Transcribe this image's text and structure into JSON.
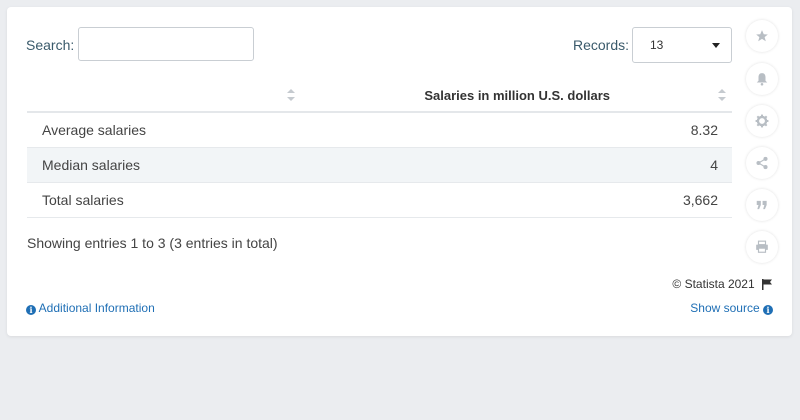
{
  "search": {
    "label": "Search:",
    "value": ""
  },
  "records": {
    "label": "Records:",
    "value": "13"
  },
  "table": {
    "columns": [
      "",
      "Salaries in million U.S. dollars"
    ],
    "rows": [
      {
        "label": "Average salaries",
        "value": "8.32"
      },
      {
        "label": "Median salaries",
        "value": "4"
      },
      {
        "label": "Total salaries",
        "value": "3,662"
      }
    ]
  },
  "summary": "Showing entries 1 to 3 (3 entries in total)",
  "footer": {
    "copyright": "© Statista 2021",
    "additional_info": "Additional Information",
    "show_source": "Show source"
  },
  "sidebar": [
    "star-icon",
    "bell-icon",
    "gear-icon",
    "share-icon",
    "quote-icon",
    "print-icon"
  ],
  "colors": {
    "link": "#1f6fb5",
    "alt_row": "#f2f5f7",
    "icon": "#b8bec4"
  },
  "chart_data": {
    "type": "table",
    "columns": [
      "",
      "Salaries in million U.S. dollars"
    ],
    "categories": [
      "Average salaries",
      "Median salaries",
      "Total salaries"
    ],
    "values": [
      8.32,
      4,
      3662
    ],
    "ylabel": "Salaries in million U.S. dollars"
  }
}
